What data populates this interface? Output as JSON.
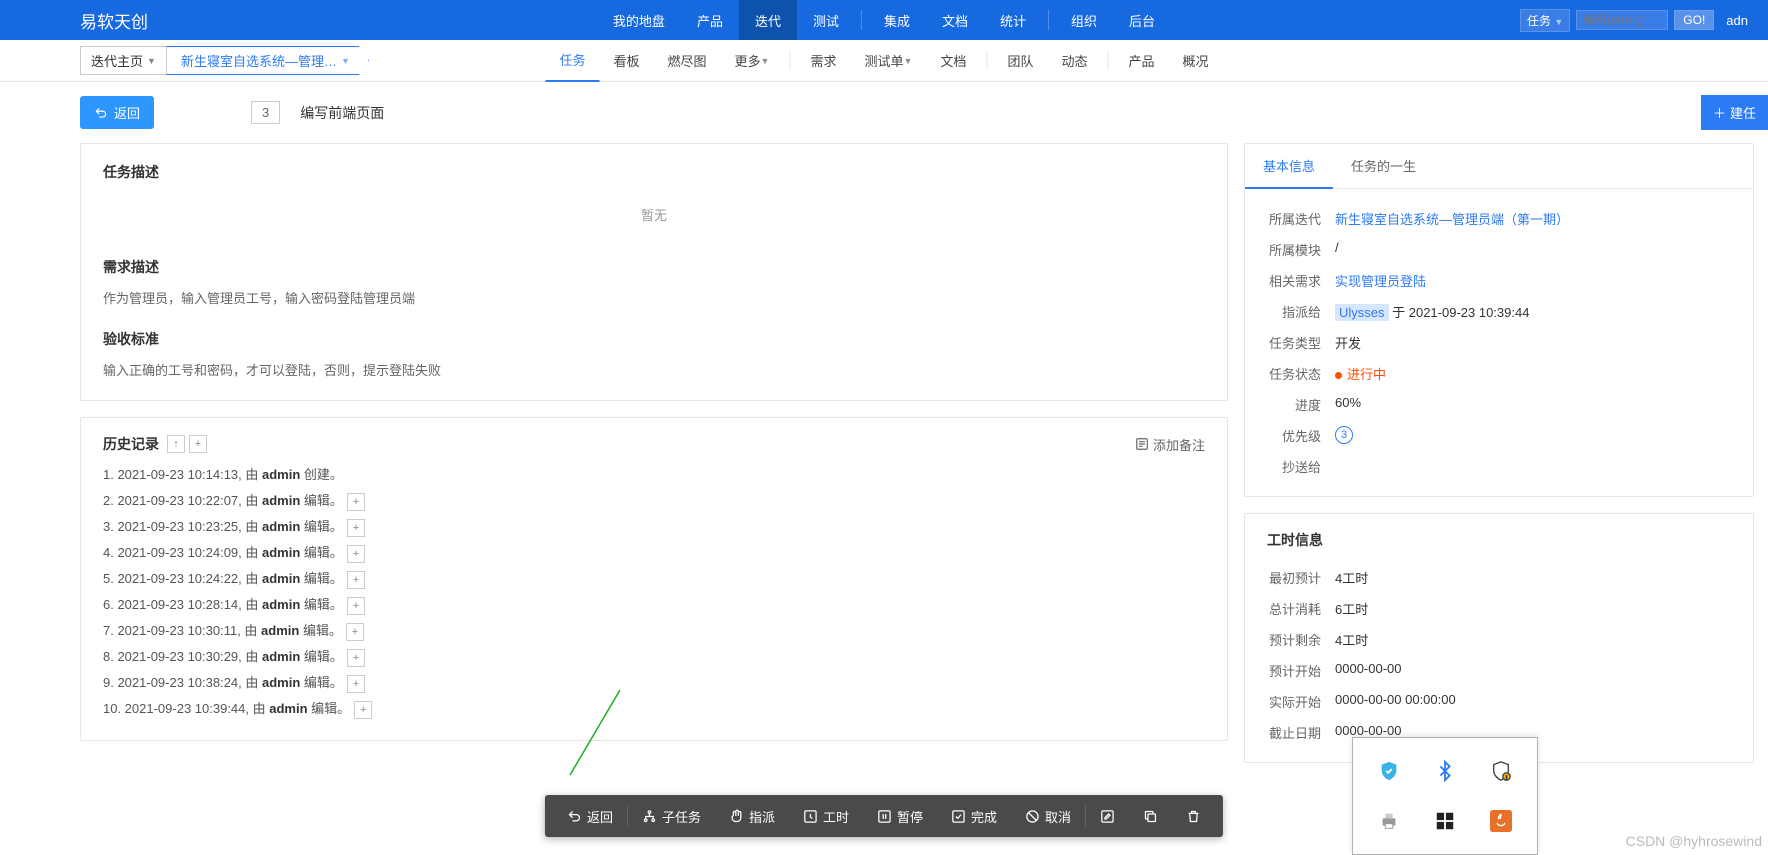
{
  "app": {
    "name": "易软天创"
  },
  "top_nav": {
    "center": [
      "我的地盘",
      "产品",
      "迭代",
      "测试",
      "集成",
      "文档",
      "统计",
      "组织",
      "后台"
    ],
    "active": 2,
    "seps_after": [
      3,
      6
    ],
    "search_type": "任务",
    "search_placeholder": "编号(ctrl+g)",
    "go": "GO!",
    "user": "adn"
  },
  "sub_nav": {
    "crumb1": "迭代主页",
    "crumb2": "新生寝室自选系统—管理…",
    "items": [
      "任务",
      "看板",
      "燃尽图",
      "更多",
      "需求",
      "测试单",
      "文档",
      "团队",
      "动态",
      "产品",
      "概况"
    ],
    "active": 0,
    "dd_after": [
      3,
      5
    ],
    "seps_after": [
      3,
      6,
      8
    ]
  },
  "toolbar": {
    "back": "返回",
    "id": "3",
    "title": "编写前端页面",
    "new": "建任"
  },
  "desc": {
    "title": "任务描述",
    "empty": "暂无"
  },
  "req": {
    "title": "需求描述",
    "body": "作为管理员，输入管理员工号，输入密码登陆管理员端"
  },
  "accept": {
    "title": "验收标准",
    "body": "输入正确的工号和密码，才可以登陆，否则，提示登陆失败"
  },
  "history": {
    "title": "历史记录",
    "add_note": "添加备注",
    "items": [
      {
        "n": "1",
        "ts": "2021-09-23 10:14:13",
        "user": "admin",
        "action": "创建",
        "expand": false
      },
      {
        "n": "2",
        "ts": "2021-09-23 10:22:07",
        "user": "admin",
        "action": "编辑",
        "expand": true
      },
      {
        "n": "3",
        "ts": "2021-09-23 10:23:25",
        "user": "admin",
        "action": "编辑",
        "expand": true
      },
      {
        "n": "4",
        "ts": "2021-09-23 10:24:09",
        "user": "admin",
        "action": "编辑",
        "expand": true
      },
      {
        "n": "5",
        "ts": "2021-09-23 10:24:22",
        "user": "admin",
        "action": "编辑",
        "expand": true
      },
      {
        "n": "6",
        "ts": "2021-09-23 10:28:14",
        "user": "admin",
        "action": "编辑",
        "expand": true
      },
      {
        "n": "7",
        "ts": "2021-09-23 10:30:11",
        "user": "admin",
        "action": "编辑",
        "expand": true
      },
      {
        "n": "8",
        "ts": "2021-09-23 10:30:29",
        "user": "admin",
        "action": "编辑",
        "expand": true
      },
      {
        "n": "9",
        "ts": "2021-09-23 10:38:24",
        "user": "admin",
        "action": "编辑",
        "expand": true
      },
      {
        "n": "10",
        "ts": "2021-09-23 10:39:44",
        "user": "admin",
        "action": "编辑",
        "expand": true
      }
    ]
  },
  "info_tabs": [
    "基本信息",
    "任务的一生"
  ],
  "basic": {
    "iteration_label": "所属迭代",
    "iteration_value": "新生寝室自选系统—管理员端（第一期）",
    "module_label": "所属模块",
    "module_value": "/",
    "req_label": "相关需求",
    "req_value": "实现管理员登陆",
    "assign_label": "指派给",
    "assign_user": "Ulysses",
    "assign_text": " 于 2021-09-23 10:39:44",
    "type_label": "任务类型",
    "type_value": "开发",
    "status_label": "任务状态",
    "status_value": "进行中",
    "progress_label": "进度",
    "progress_value": "60%",
    "priority_label": "优先级",
    "priority_value": "3",
    "cc_label": "抄送给",
    "cc_value": ""
  },
  "effort": {
    "title": "工时信息",
    "estimate_label": "最初预计",
    "estimate_value": "4工时",
    "consumed_label": "总计消耗",
    "consumed_value": "6工时",
    "left_label": "预计剩余",
    "left_value": "4工时",
    "est_start_label": "预计开始",
    "est_start_value": "0000-00-00",
    "real_start_label": "实际开始",
    "real_start_value": "0000-00-00 00:00:00",
    "deadline_label": "截止日期",
    "deadline_value": "0000-00-00"
  },
  "actions": {
    "back": "返回",
    "subtask": "子任务",
    "assign": "指派",
    "effort": "工时",
    "pause": "暂停",
    "finish": "完成",
    "cancel": "取消"
  },
  "tray_icons": [
    "shield-icon",
    "bluetooth-icon",
    "defender-icon",
    "printer-icon",
    "app-icon",
    "java-icon"
  ],
  "watermark": "CSDN @hyhrosewind"
}
